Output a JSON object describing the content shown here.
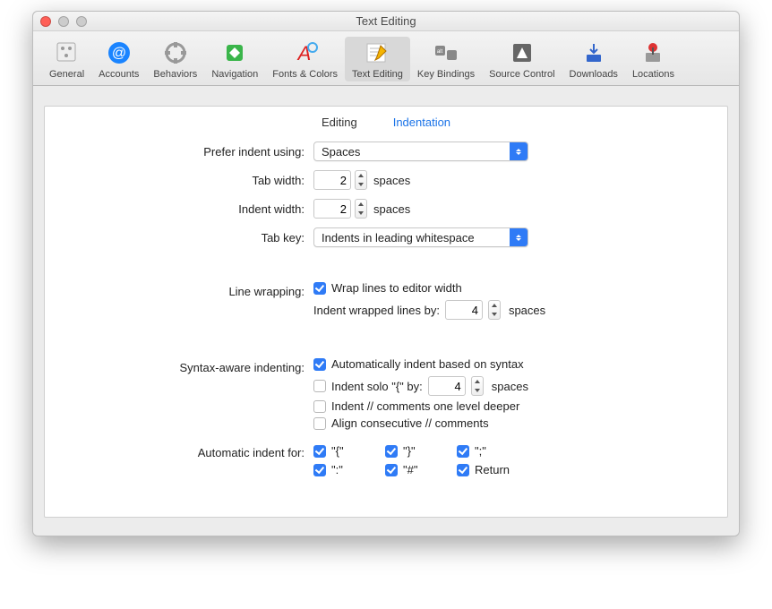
{
  "window_title": "Text Editing",
  "toolbar": [
    {
      "id": "general",
      "label": "General"
    },
    {
      "id": "accounts",
      "label": "Accounts"
    },
    {
      "id": "behaviors",
      "label": "Behaviors"
    },
    {
      "id": "navigation",
      "label": "Navigation"
    },
    {
      "id": "fontscolors",
      "label": "Fonts & Colors"
    },
    {
      "id": "textediting",
      "label": "Text Editing"
    },
    {
      "id": "keybindings",
      "label": "Key Bindings"
    },
    {
      "id": "sourcecontrol",
      "label": "Source Control"
    },
    {
      "id": "downloads",
      "label": "Downloads"
    },
    {
      "id": "locations",
      "label": "Locations"
    }
  ],
  "toolbar_selected": "textediting",
  "subtabs": {
    "editing": "Editing",
    "indentation": "Indentation",
    "active": "indentation"
  },
  "labels": {
    "prefer_indent": "Prefer indent using:",
    "tab_width": "Tab width:",
    "indent_width": "Indent width:",
    "tab_key": "Tab key:",
    "line_wrapping": "Line wrapping:",
    "syntax_indent": "Syntax-aware indenting:",
    "auto_for": "Automatic indent for:",
    "spaces": "spaces",
    "wrap_lines": "Wrap lines to editor width",
    "indent_wrapped_pre": "Indent wrapped lines by:",
    "auto_syntax": "Automatically indent based on syntax",
    "indent_solo_pre": "Indent solo \"{\" by:",
    "indent_comments": "Indent // comments one level deeper",
    "align_comments": "Align consecutive // comments"
  },
  "values": {
    "prefer_indent": "Spaces",
    "tab_width": "2",
    "indent_width": "2",
    "tab_key": "Indents in leading whitespace",
    "indent_wrapped": "4",
    "indent_solo": "4"
  },
  "checks": {
    "wrap_lines": true,
    "auto_syntax": true,
    "indent_solo": false,
    "indent_comments": false,
    "align_comments": false
  },
  "auto_for": [
    {
      "label": "\"{\"",
      "on": true
    },
    {
      "label": "\"}\"",
      "on": true
    },
    {
      "label": "\";\"",
      "on": true
    },
    {
      "label": "\":\"",
      "on": true
    },
    {
      "label": "\"#\"",
      "on": true
    },
    {
      "label": "Return",
      "on": true
    }
  ]
}
